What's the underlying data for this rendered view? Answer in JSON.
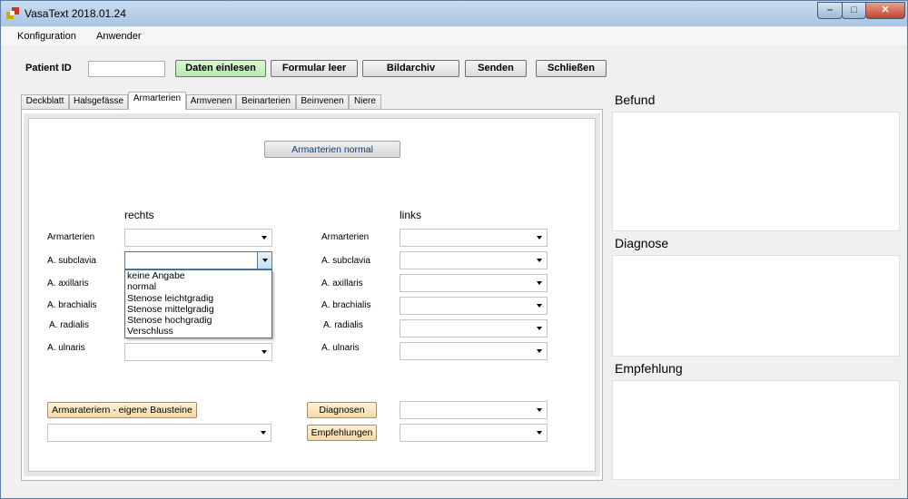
{
  "window": {
    "title": "VasaText  2018.01.24",
    "min": "–",
    "max": "□",
    "close": "✕"
  },
  "menu": {
    "konfiguration": "Konfiguration",
    "anwender": "Anwender"
  },
  "toolbar": {
    "patient_label": "Patient ID",
    "patient_value": "",
    "daten": "Daten einlesen",
    "formular": "Formular leer",
    "bildarchiv": "Bildarchiv",
    "senden": "Senden",
    "schliessen": "Schließen"
  },
  "tabs": [
    "Deckblatt",
    "Halsgefässe",
    "Armarterien",
    "Armvenen",
    "Beinarterien",
    "Beinvenen",
    "Niere"
  ],
  "active_tab": "Armarterien",
  "panel": {
    "normal_button": "Armarterien normal",
    "rechts": "rechts",
    "links": "links",
    "rows": [
      "Armarterien",
      "A. subclavia",
      "A. axillaris",
      "A. brachialis",
      "A. radialis",
      "A. ulnaris"
    ],
    "dropdown_options": [
      "keine Angabe",
      "normal",
      "Stenose leichtgradig",
      "Stenose mittelgradig",
      "Stenose hochgradig",
      "Verschluss"
    ],
    "bausteine_button": "Armarateriern - eigene Bausteine",
    "diagnosen_button": "Diagnosen",
    "empfehlungen_button": "Empfehlungen"
  },
  "side": {
    "befund": "Befund",
    "diagnose": "Diagnose",
    "empfehlung": "Empfehlung"
  },
  "colors": {
    "green_button": "#c6f0bf",
    "amber_button": "#f8dfb0",
    "accent_blue": "#3c7fb1"
  }
}
